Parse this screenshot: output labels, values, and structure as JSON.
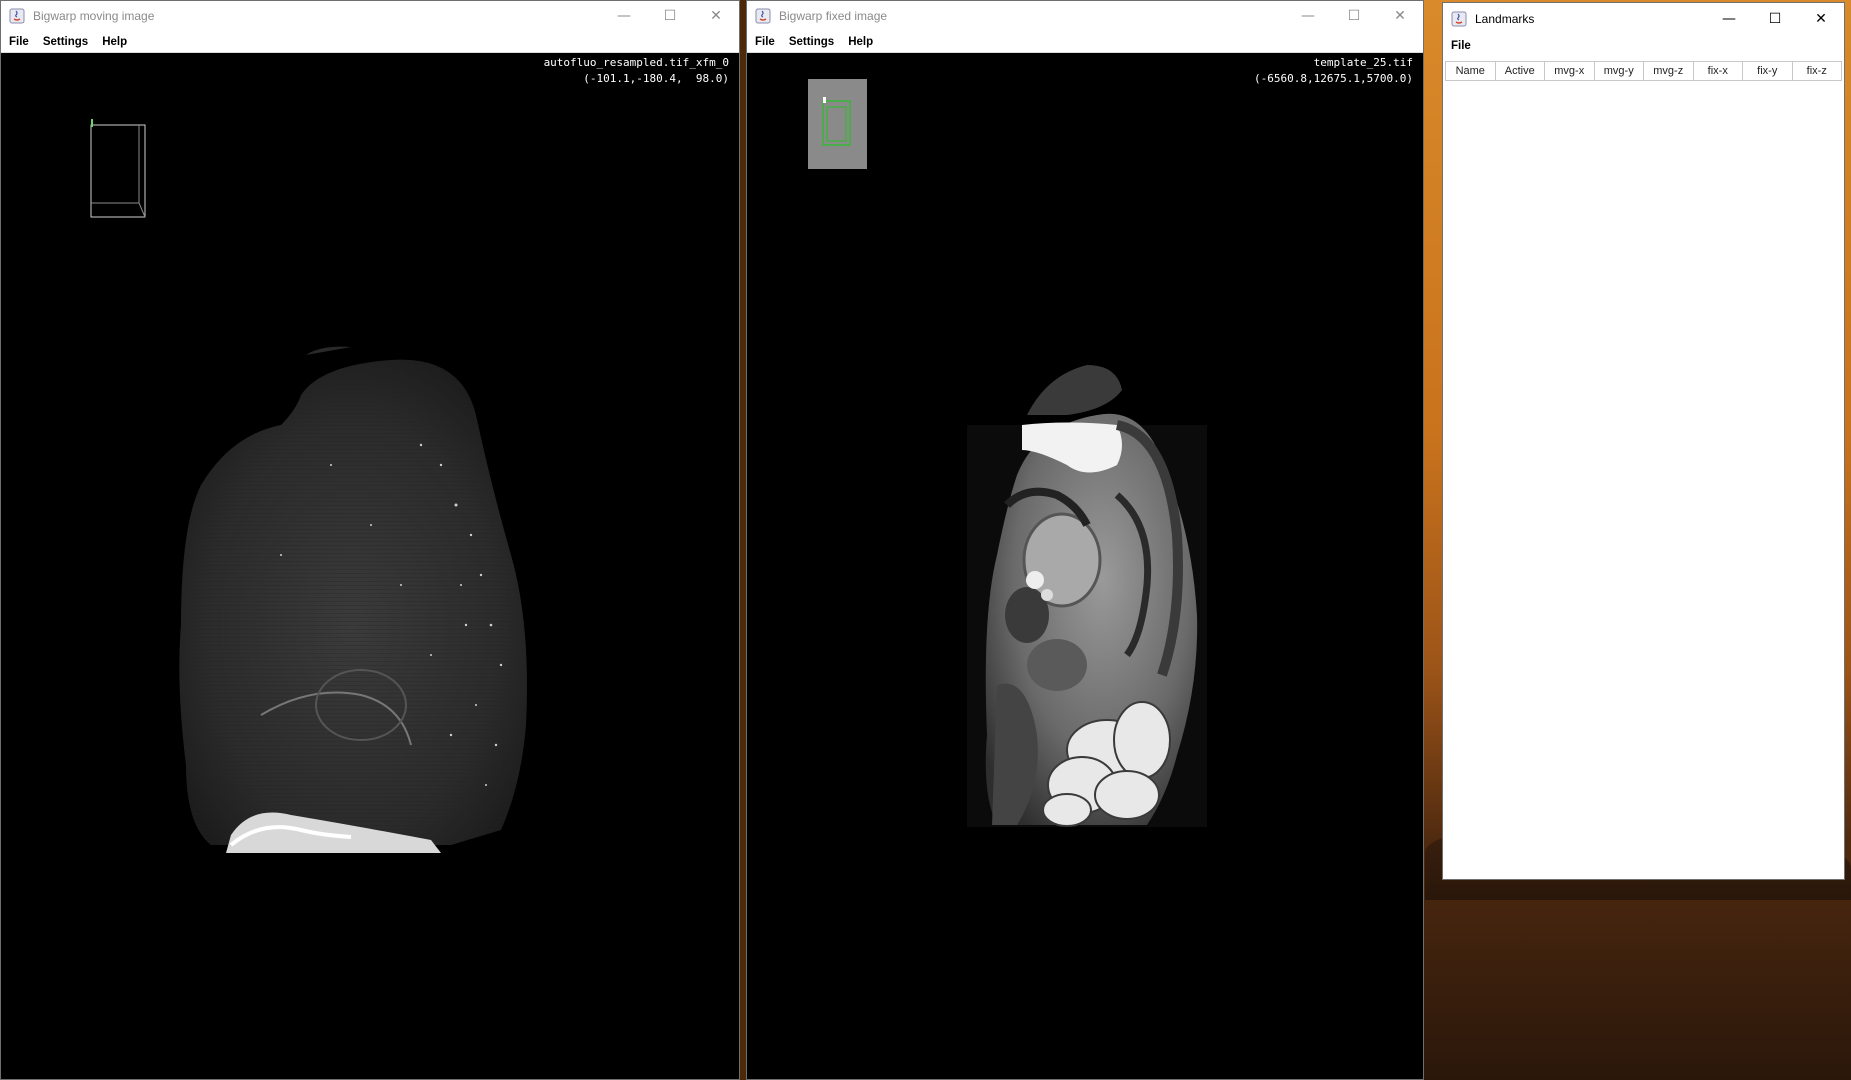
{
  "moving_window": {
    "title": "Bigwarp moving image",
    "menu": [
      "File",
      "Settings",
      "Help"
    ],
    "overlay_name": "autofluo_resampled.tif_xfm_0",
    "overlay_coords": "(-101.1,-180.4,  98.0)"
  },
  "fixed_window": {
    "title": "Bigwarp fixed image",
    "menu": [
      "File",
      "Settings",
      "Help"
    ],
    "overlay_name": "template_25.tif",
    "overlay_coords": "(-6560.8,12675.1,5700.0)"
  },
  "landmarks_window": {
    "title": "Landmarks",
    "menu": [
      "File"
    ],
    "columns": [
      "Name",
      "Active",
      "mvg-x",
      "mvg-y",
      "mvg-z",
      "fix-x",
      "fix-y",
      "fix-z"
    ]
  },
  "window_controls": {
    "minimize": "—",
    "maximize": "☐",
    "close": "✕"
  },
  "colors": {
    "bounding_box": "#ffffff",
    "fixed_box_outline": "#22c322",
    "titlebar_bg": "#ffffff",
    "viewer_bg": "#000000"
  }
}
